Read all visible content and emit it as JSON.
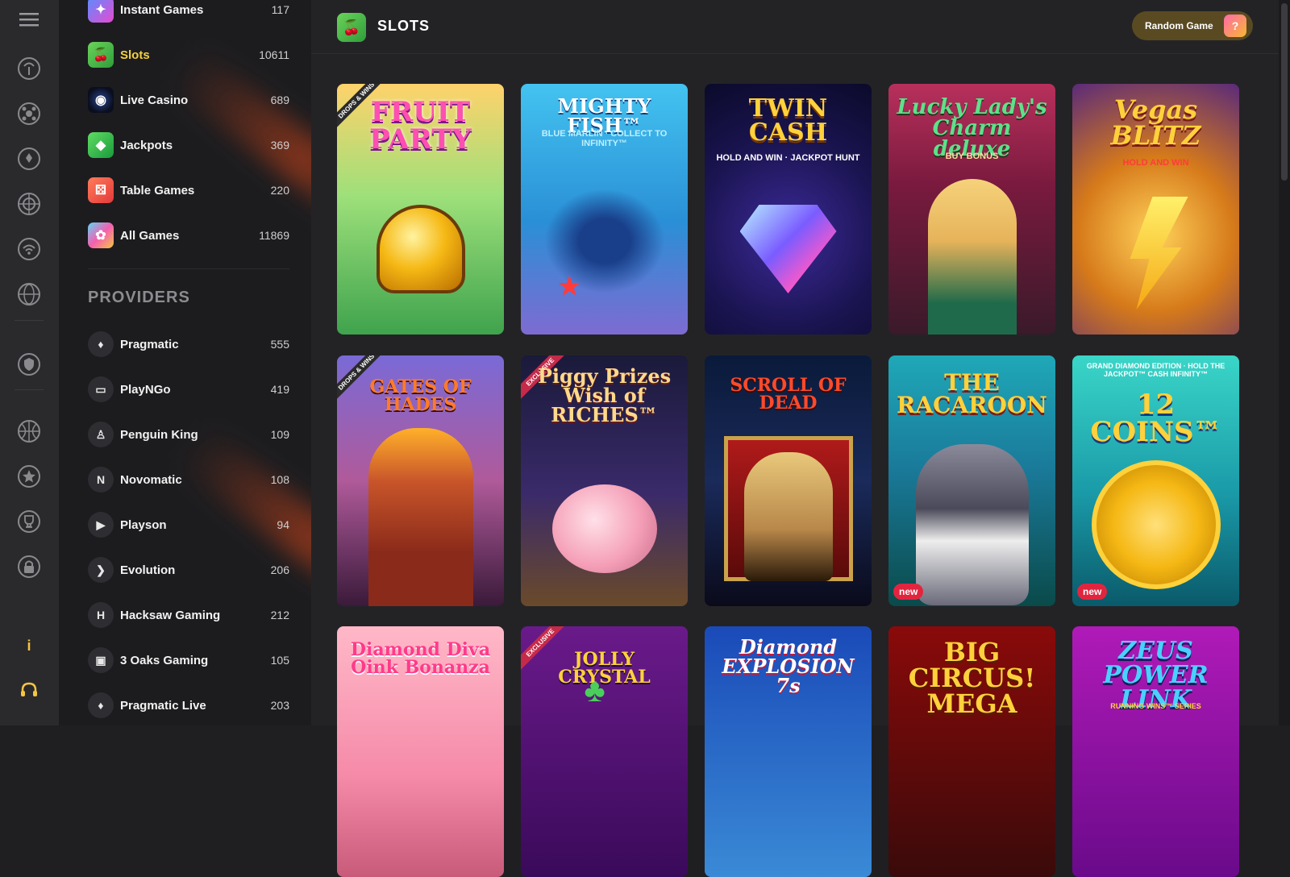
{
  "rail": {
    "menu_icon": "hamburger-icon",
    "items": [
      "palm-icon",
      "soccer-icon",
      "clover-icon",
      "wheel-icon",
      "wifi-icon",
      "globe-icon",
      "shield-icon",
      "basketball-icon",
      "star-icon",
      "trophy-icon",
      "lock-icon",
      "info-icon",
      "headset-icon"
    ],
    "info_label": "i"
  },
  "sidebar": {
    "categories": [
      {
        "label": "Instant Games",
        "count": "117"
      },
      {
        "label": "Slots",
        "count": "10611",
        "active": true
      },
      {
        "label": "Live Casino",
        "count": "689"
      },
      {
        "label": "Jackpots",
        "count": "369"
      },
      {
        "label": "Table Games",
        "count": "220"
      },
      {
        "label": "All Games",
        "count": "11869"
      }
    ],
    "providers_title": "PROVIDERS",
    "providers": [
      {
        "label": "Pragmatic",
        "count": "555",
        "glyph": "♦"
      },
      {
        "label": "PlayNGo",
        "count": "419",
        "glyph": "▭"
      },
      {
        "label": "Penguin King",
        "count": "109",
        "glyph": "♙"
      },
      {
        "label": "Novomatic",
        "count": "108",
        "glyph": "N"
      },
      {
        "label": "Playson",
        "count": "94",
        "glyph": "▶"
      },
      {
        "label": "Evolution",
        "count": "206",
        "glyph": "❯"
      },
      {
        "label": "Hacksaw Gaming",
        "count": "212",
        "glyph": "H"
      },
      {
        "label": "3 Oaks Gaming",
        "count": "105",
        "glyph": "▣"
      },
      {
        "label": "Pragmatic Live",
        "count": "203",
        "glyph": "♦"
      }
    ]
  },
  "header": {
    "title": "SLOTS",
    "random_button": "Random Game"
  },
  "games": [
    {
      "title": "FRUIT PARTY",
      "sub": "",
      "tag": "DROPS & WINS"
    },
    {
      "title": "MIGHTY FISH™",
      "sub": "BLUE MARLIN · COLLECT TO INFINITY™",
      "tag": ""
    },
    {
      "title": "TWIN CASH",
      "sub": "HOLD AND WIN · JACKPOT HUNT",
      "tag": ""
    },
    {
      "title": "Lucky Lady's Charm deluxe",
      "sub": "BUY BONUS",
      "tag": ""
    },
    {
      "title": "Vegas BLITZ",
      "sub": "HOLD AND WIN",
      "tag": ""
    },
    {
      "title": "GATES OF HADES",
      "sub": "",
      "tag": "DROPS & WINS"
    },
    {
      "title": "Piggy Prizes Wish of RICHES™",
      "sub": "",
      "tag": "EXCLUSIVE"
    },
    {
      "title": "SCROLL OF DEAD",
      "sub": "",
      "tag": ""
    },
    {
      "title": "THE RACAROON",
      "sub": "",
      "tag": "",
      "badge": "new"
    },
    {
      "title": "12 COINS™",
      "sub": "GRAND DIAMOND EDITION · HOLD THE JACKPOT™ CASH INFINITY™",
      "tag": "",
      "badge": "new"
    },
    {
      "title": "Diamond Diva Oink Bonanza",
      "sub": "",
      "tag": ""
    },
    {
      "title": "JOLLY CRYSTAL",
      "sub": "",
      "tag": "EXCLUSIVE"
    },
    {
      "title": "Diamond EXPLOSION 7s",
      "sub": "",
      "tag": ""
    },
    {
      "title": "BIG CIRCUS! MEGA",
      "sub": "",
      "tag": ""
    },
    {
      "title": "ZEUS POWER LINK",
      "sub": "RUNNING WINS™ SERIES",
      "tag": ""
    }
  ],
  "colors": {
    "accent": "#f5d042",
    "new_badge": "#e2253f"
  }
}
